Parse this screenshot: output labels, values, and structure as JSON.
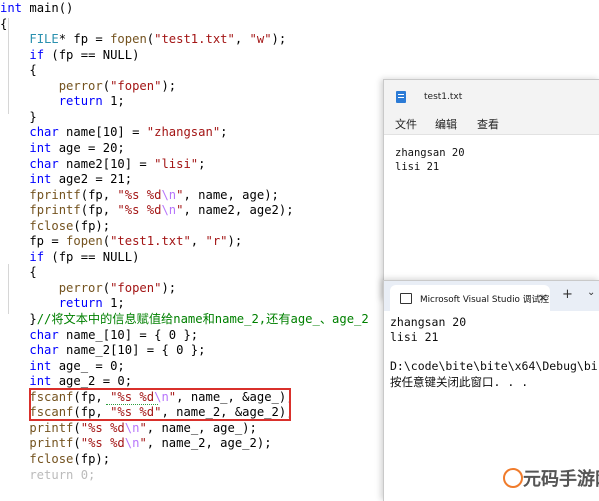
{
  "editor": {
    "lines": [
      [
        [
          "kw",
          "int"
        ],
        [
          "tx",
          " main()"
        ]
      ],
      [
        [
          "tx",
          "{"
        ]
      ],
      [
        [
          "tx",
          "    "
        ],
        [
          "ty",
          "FILE"
        ],
        [
          "tx",
          "* fp = "
        ],
        [
          "fn",
          "fopen"
        ],
        [
          "tx",
          "("
        ],
        [
          "str",
          "\"test1.txt\""
        ],
        [
          "tx",
          ", "
        ],
        [
          "str",
          "\"w\""
        ],
        [
          "tx",
          ");"
        ]
      ],
      [
        [
          "tx",
          "    "
        ],
        [
          "kw",
          "if"
        ],
        [
          "tx",
          " (fp == NULL)"
        ]
      ],
      [
        [
          "tx",
          "    {"
        ]
      ],
      [
        [
          "tx",
          "        "
        ],
        [
          "fn",
          "perror"
        ],
        [
          "tx",
          "("
        ],
        [
          "str",
          "\"fopen\""
        ],
        [
          "tx",
          ");"
        ]
      ],
      [
        [
          "tx",
          "        "
        ],
        [
          "kw",
          "return"
        ],
        [
          "tx",
          " 1;"
        ]
      ],
      [
        [
          "tx",
          "    }"
        ]
      ],
      [
        [
          "tx",
          "    "
        ],
        [
          "kw",
          "char"
        ],
        [
          "tx",
          " name[10] = "
        ],
        [
          "str",
          "\"zhangsan\""
        ],
        [
          "tx",
          ";"
        ]
      ],
      [
        [
          "tx",
          "    "
        ],
        [
          "kw",
          "int"
        ],
        [
          "tx",
          " age = 20;"
        ]
      ],
      [
        [
          "tx",
          "    "
        ],
        [
          "kw",
          "char"
        ],
        [
          "tx",
          " name2[10] = "
        ],
        [
          "str",
          "\"lisi\""
        ],
        [
          "tx",
          ";"
        ]
      ],
      [
        [
          "tx",
          "    "
        ],
        [
          "kw",
          "int"
        ],
        [
          "tx",
          " age2 = 21;"
        ]
      ],
      [
        [
          "tx",
          "    "
        ],
        [
          "fn",
          "fprintf"
        ],
        [
          "tx",
          "(fp, "
        ],
        [
          "str",
          "\"%s %d"
        ],
        [
          "esc",
          "\\n"
        ],
        [
          "str",
          "\""
        ],
        [
          "tx",
          ", name, age);"
        ]
      ],
      [
        [
          "tx",
          "    "
        ],
        [
          "fn",
          "fprintf"
        ],
        [
          "tx",
          "(fp, "
        ],
        [
          "str",
          "\"%s %d"
        ],
        [
          "esc",
          "\\n"
        ],
        [
          "str",
          "\""
        ],
        [
          "tx",
          ", name2, age2);"
        ]
      ],
      [
        [
          "tx",
          "    "
        ],
        [
          "fn",
          "fclose"
        ],
        [
          "tx",
          "(fp);"
        ]
      ],
      [
        [
          "tx",
          "    fp = "
        ],
        [
          "fn",
          "fopen"
        ],
        [
          "tx",
          "("
        ],
        [
          "str",
          "\"test1.txt\""
        ],
        [
          "tx",
          ", "
        ],
        [
          "str",
          "\"r\""
        ],
        [
          "tx",
          ");"
        ]
      ],
      [
        [
          "tx",
          "    "
        ],
        [
          "kw",
          "if"
        ],
        [
          "tx",
          " (fp == NULL)"
        ]
      ],
      [
        [
          "tx",
          "    {"
        ]
      ],
      [
        [
          "tx",
          "        "
        ],
        [
          "fn",
          "perror"
        ],
        [
          "tx",
          "("
        ],
        [
          "str",
          "\"fopen\""
        ],
        [
          "tx",
          ");"
        ]
      ],
      [
        [
          "tx",
          "        "
        ],
        [
          "kw",
          "return"
        ],
        [
          "tx",
          " 1;"
        ]
      ],
      [
        [
          "tx",
          "    }"
        ],
        [
          "cm",
          "//将文本中的信息赋值给name和name_2,还有age_、age_2"
        ]
      ],
      [
        [
          "tx",
          "    "
        ],
        [
          "kw",
          "char"
        ],
        [
          "tx",
          " name_[10] = { 0 };"
        ]
      ],
      [
        [
          "tx",
          "    "
        ],
        [
          "kw",
          "char"
        ],
        [
          "tx",
          " name_2[10] = { 0 };"
        ]
      ],
      [
        [
          "tx",
          "    "
        ],
        [
          "kw",
          "int"
        ],
        [
          "tx",
          " age_ = 0;"
        ]
      ],
      [
        [
          "tx",
          "    "
        ],
        [
          "kw",
          "int"
        ],
        [
          "tx",
          " age_2 = 0;"
        ]
      ],
      [
        [
          "tx",
          "    "
        ],
        [
          "fn",
          "fscanf"
        ],
        [
          "tx",
          "(fp, "
        ],
        [
          "str",
          "\"%s %d"
        ],
        [
          "esc",
          "\\n"
        ],
        [
          "str",
          "\""
        ],
        [
          "tx",
          ", name_, &age_);"
        ]
      ],
      [
        [
          "tx",
          "    "
        ],
        [
          "fn",
          "fscanf"
        ],
        [
          "tx",
          "(fp, "
        ],
        [
          "str",
          "\"%s %d\""
        ],
        [
          "tx",
          ", name_2, &age_2);"
        ]
      ],
      [
        [
          "tx",
          "    "
        ],
        [
          "fn",
          "printf"
        ],
        [
          "tx",
          "("
        ],
        [
          "str",
          "\"%s %d"
        ],
        [
          "esc",
          "\\n"
        ],
        [
          "str",
          "\""
        ],
        [
          "tx",
          ", name_, age_);"
        ]
      ],
      [
        [
          "tx",
          "    "
        ],
        [
          "fn",
          "printf"
        ],
        [
          "tx",
          "("
        ],
        [
          "str",
          "\"%s %d"
        ],
        [
          "esc",
          "\\n"
        ],
        [
          "str",
          "\""
        ],
        [
          "tx",
          ", name_2, age_2);"
        ]
      ],
      [
        [
          "tx",
          "    "
        ],
        [
          "fn",
          "fclose"
        ],
        [
          "tx",
          "(fp);"
        ]
      ],
      [
        [
          "dim",
          "    return 0;"
        ]
      ]
    ]
  },
  "notepad": {
    "title": "test1.txt",
    "menu": [
      "文件",
      "编辑",
      "查看"
    ],
    "content": [
      "zhangsan 20",
      "lisi 21"
    ]
  },
  "console": {
    "tab_title": "Microsoft Visual Studio 调试控",
    "close": "×",
    "add": "+",
    "dropdown": "⌄",
    "output": [
      "zhangsan 20",
      "lisi 21",
      "",
      "D:\\code\\bite\\bite\\x64\\Debug\\bi",
      "按任意键关闭此窗口. . ."
    ]
  },
  "watermark": {
    "text": "元码手游网"
  },
  "colors": {
    "keyword": "#0000ff",
    "type": "#2b91af",
    "function": "#74531f",
    "string": "#a31515",
    "escape": "#b776fb",
    "comment": "#008000",
    "highlight_box": "#d9302b"
  }
}
